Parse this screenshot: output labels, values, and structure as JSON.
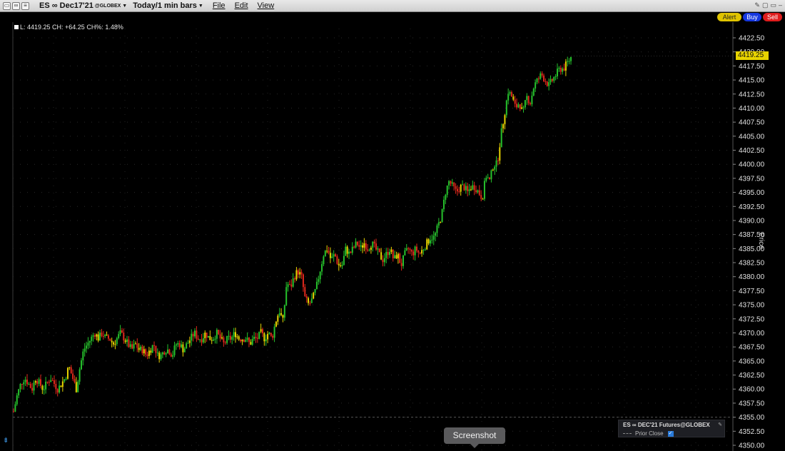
{
  "toolbar": {
    "symbol": "ES ∞ Dec17'21",
    "exchange": "@GLOBEX",
    "bar_setting": "Today/1 min bars",
    "menus": [
      "File",
      "Edit",
      "View"
    ]
  },
  "actions": {
    "alert": "Alert",
    "buy": "Buy",
    "sell": "Sell"
  },
  "stats": "L: 4419.25 CH: +64.25 CH%: 1.48%",
  "price_tag": "4419.25",
  "axis_title": "Price",
  "legend": {
    "title": "ES ∞ DEC'21 Futures@GLOBEX",
    "row": "Prior Close"
  },
  "tooltip": "Screenshot",
  "colors": {
    "up": "#26c22c",
    "down": "#e0281c",
    "doji": "#e8d400",
    "background": "#000000",
    "grid": "#2a2a2a"
  },
  "chart_data": {
    "type": "candlestick",
    "y_ticks": [
      "4422.50",
      "4420.00",
      "4417.50",
      "4415.00",
      "4412.50",
      "4410.00",
      "4407.50",
      "4405.00",
      "4402.50",
      "4400.00",
      "4397.50",
      "4395.00",
      "4392.50",
      "4390.00",
      "4387.50",
      "4385.00",
      "4382.50",
      "4380.00",
      "4377.50",
      "4375.00",
      "4372.50",
      "4370.00",
      "4367.50",
      "4365.00",
      "4362.50",
      "4360.00",
      "4357.50",
      "4355.00",
      "4352.50",
      "4350.00"
    ],
    "ylim": [
      4350,
      4422.5
    ],
    "prior_close": 4355.0,
    "last": 4419.25,
    "ylabel": "Price",
    "path": [
      4356,
      4359,
      4361,
      4362,
      4361,
      4360,
      4362,
      4361,
      4360,
      4361,
      4362,
      4361,
      4360,
      4361,
      4362,
      4364,
      4362,
      4360,
      4364,
      4367,
      4368,
      4369,
      4370,
      4369,
      4370,
      4369,
      4369,
      4368,
      4369,
      4370,
      4369,
      4368,
      4367,
      4368,
      4367,
      4367,
      4366,
      4367,
      4368,
      4366,
      4366,
      4367,
      4367,
      4366,
      4368,
      4368,
      4367,
      4368,
      4369,
      4370,
      4369,
      4369,
      4370,
      4369,
      4369,
      4370,
      4369,
      4368,
      4369,
      4369,
      4370,
      4369,
      4369,
      4369,
      4368,
      4369,
      4369,
      4370,
      4369,
      4370,
      4369,
      4372,
      4374,
      4372,
      4379,
      4378,
      4380,
      4381,
      4380,
      4376,
      4375,
      4376,
      4378,
      4381,
      4384,
      4385,
      4383,
      4384,
      4382,
      4382,
      4385,
      4384,
      4385,
      4386,
      4385,
      4386,
      4385,
      4386,
      4385,
      4384,
      4383,
      4384,
      4385,
      4383,
      4384,
      4382,
      4384,
      4385,
      4384,
      4385,
      4384,
      4385,
      4386,
      4387,
      4387,
      4389,
      4391,
      4395,
      4397,
      4396,
      4395,
      4396,
      4396,
      4395,
      4396,
      4396,
      4395,
      4394,
      4398,
      4397,
      4400,
      4400,
      4405,
      4409,
      4413,
      4412,
      4410,
      4411,
      4409,
      4412,
      4411,
      4414,
      4415,
      4416,
      4415,
      4414,
      4415,
      4416,
      4417,
      4417,
      4418,
      4419
    ]
  }
}
